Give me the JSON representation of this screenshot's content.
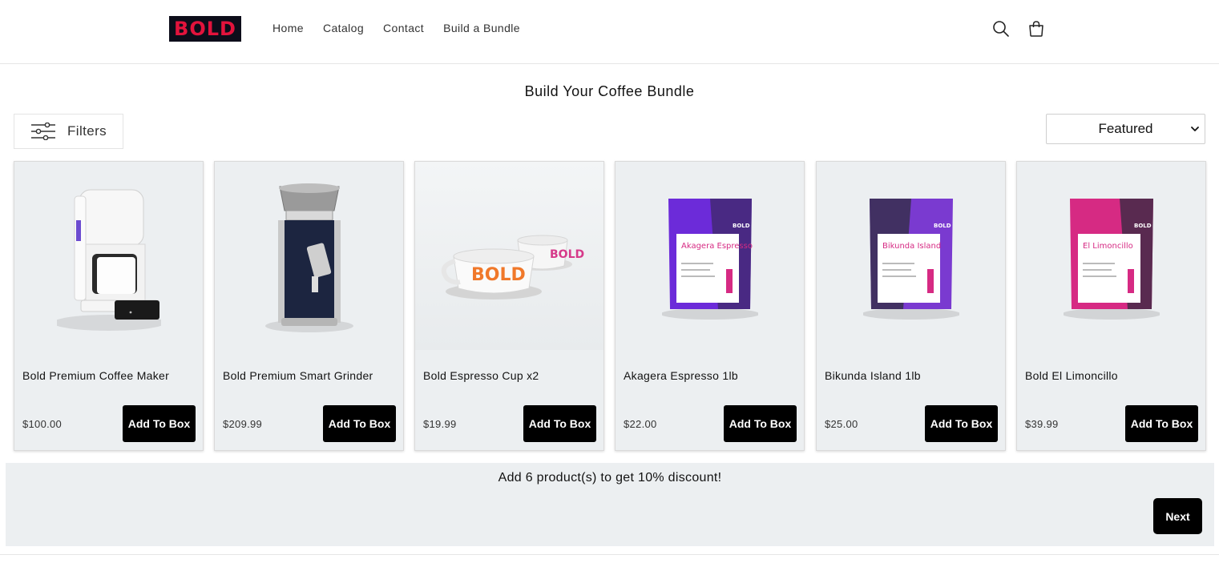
{
  "brand": {
    "logo_text": "BOLD",
    "logo_bg": "#0d0d1a",
    "logo_color": "#e3133c"
  },
  "nav": {
    "items": [
      "Home",
      "Catalog",
      "Contact",
      "Build a Bundle"
    ]
  },
  "header_icons": {
    "search": "search-icon",
    "cart": "cart-icon"
  },
  "page": {
    "title": "Build Your Coffee Bundle"
  },
  "filters": {
    "label": "Filters",
    "icon": "sliders-icon"
  },
  "sort": {
    "selected": "Featured",
    "icon": "chevron-down-icon"
  },
  "products": [
    {
      "name": "Bold Premium Coffee Maker",
      "price": "$100.00",
      "button": "Add To Box"
    },
    {
      "name": "Bold Premium Smart Grinder",
      "price": "$209.99",
      "button": "Add To Box"
    },
    {
      "name": "Bold Espresso Cup x2",
      "price": "$19.99",
      "button": "Add To Box"
    },
    {
      "name": "Akagera Espresso 1lb",
      "price": "$22.00",
      "button": "Add To Box",
      "bag_label": "Akagera Espresso",
      "bag_color": "#6c2bd9"
    },
    {
      "name": "Bikunda Island 1lb",
      "price": "$25.00",
      "button": "Add To Box",
      "bag_label": "Bikunda Island",
      "bag_color": "#7a3ad0"
    },
    {
      "name": "Bold El Limoncillo",
      "price": "$39.99",
      "button": "Add To Box",
      "bag_label": "El Limoncillo",
      "bag_color": "#d62a83"
    }
  ],
  "bundle": {
    "message": "Add 6 product(s) to get 10% discount!",
    "next_label": "Next"
  }
}
